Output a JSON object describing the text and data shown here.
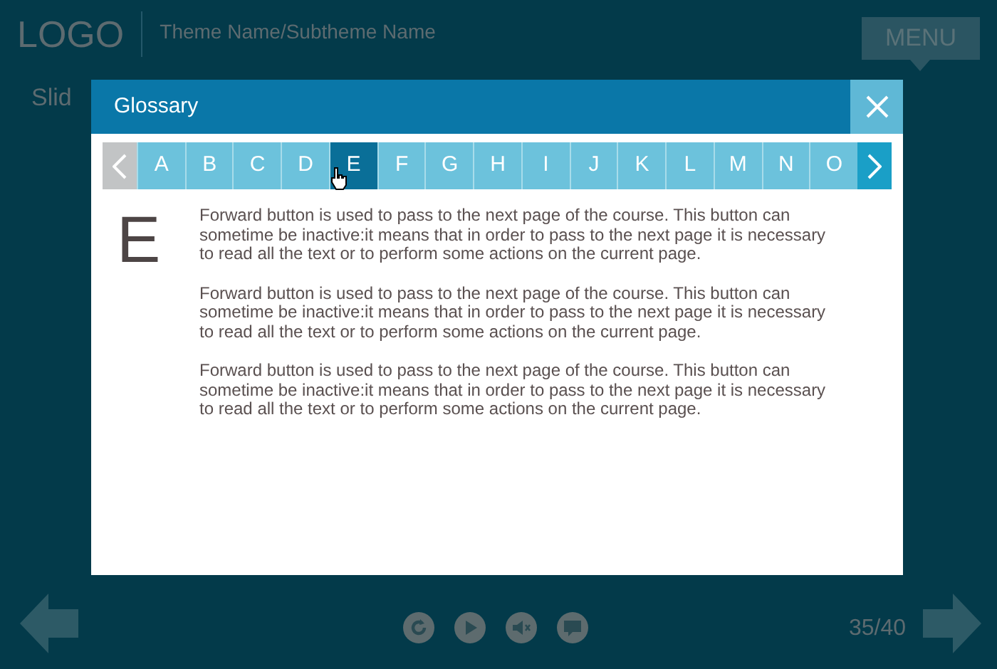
{
  "header": {
    "logo": "LOGO",
    "theme": "Theme Name/Subtheme Name",
    "menu": "MENU"
  },
  "slide_title": "Slid",
  "glossary": {
    "title": "Glossary",
    "prev": {
      "disabled": true
    },
    "next": {
      "disabled": false
    },
    "letters": [
      {
        "label": "A",
        "selected": false
      },
      {
        "label": "B",
        "selected": false
      },
      {
        "label": "C",
        "selected": false
      },
      {
        "label": "D",
        "selected": false
      },
      {
        "label": "E",
        "selected": true
      },
      {
        "label": "F",
        "selected": false
      },
      {
        "label": "G",
        "selected": false
      },
      {
        "label": "H",
        "selected": false
      },
      {
        "label": "I",
        "selected": false
      },
      {
        "label": "J",
        "selected": false
      },
      {
        "label": "K",
        "selected": false
      },
      {
        "label": "L",
        "selected": false
      },
      {
        "label": "M",
        "selected": false
      },
      {
        "label": "N",
        "selected": false
      },
      {
        "label": "O",
        "selected": false
      }
    ],
    "entry_letter": "E",
    "paragraphs": [
      "Forward button is used to pass to the next page of the course. This button can sometime be inactive:it means that in order to pass to the next page it is necessary to read all the text or to perform some actions on the current page.",
      "Forward button is used to pass to the next page of the course. This button can sometime be inactive:it means that in order to pass to the next page it is necessary to read all the text or to perform some actions on the current page.",
      "Forward button is used to pass to the next page of the course. This button can sometime be inactive:it means that in order to pass to the next page it is necessary to read all the text or to perform some actions on the current page."
    ]
  },
  "footer": {
    "page": "35/40"
  }
}
